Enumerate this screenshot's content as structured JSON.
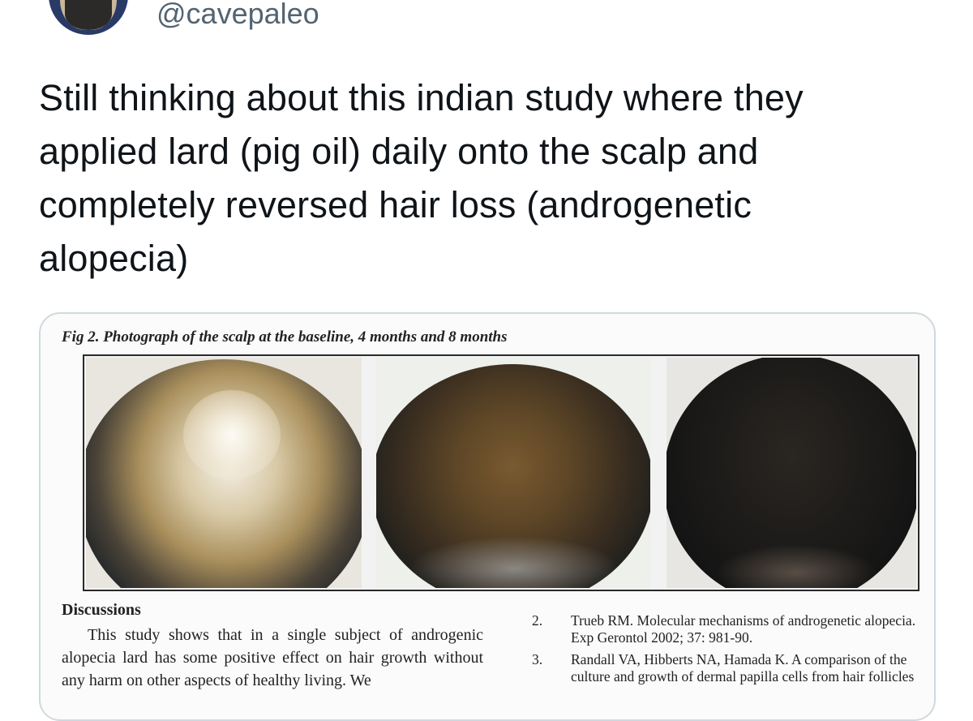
{
  "author": {
    "handle": "@cavepaleo"
  },
  "tweet": {
    "text": "Still thinking about this indian study where they\napplied lard (pig oil) daily onto the scalp and\ncompletely reversed hair loss (androgenetic\nalopecia)"
  },
  "media": {
    "figure_caption": "Fig 2. Photograph of the scalp at the baseline, 4 months and 8 months",
    "discussion_title": "Discussions",
    "discussion_body": "This study shows that in a single subject of androgenic alopecia lard has some positive effect on hair growth without any harm on other aspects of healthy living. We",
    "references": [
      {
        "num": "2.",
        "text": "Trueb RM. Molecular mechanisms of androgenetic alopecia. Exp Gerontol 2002; 37: 981-90."
      },
      {
        "num": "3.",
        "text": "Randall VA, Hibberts NA, Hamada K. A comparison of the culture and growth of dermal papilla cells from hair follicles"
      }
    ]
  },
  "colors": {
    "text": "#0f1419",
    "secondary": "#536471",
    "card_border": "#cfd9de"
  },
  "icons": {
    "avatar": "bearded-man-avatar"
  }
}
